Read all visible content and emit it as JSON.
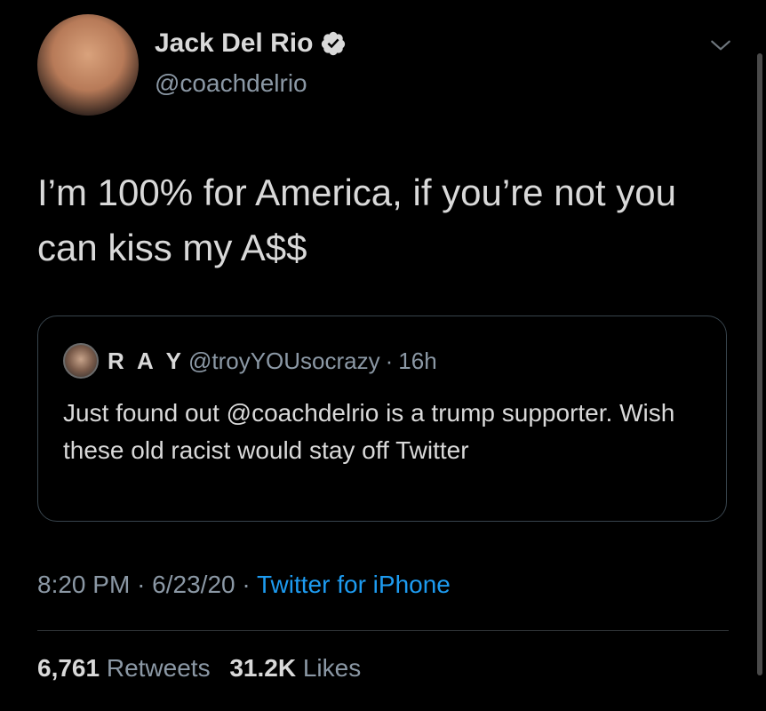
{
  "author": {
    "name": "Jack Del Rio",
    "handle": "@coachdelrio",
    "verified": true
  },
  "tweet": {
    "text": "I’m 100% for America, if you’re not you can kiss my A$$"
  },
  "quoted_tweet": {
    "name": "R A Y",
    "handle": "@troyYOUsocrazy",
    "separator": "·",
    "time": "16h",
    "text": "Just found out @coachdelrio  is a trump supporter. Wish these old racist would stay off Twitter"
  },
  "meta": {
    "time": "8:20 PM",
    "date": "6/23/20",
    "separator": "·",
    "source": "Twitter for iPhone"
  },
  "stats": {
    "retweets_count": "6,761",
    "retweets_label": "Retweets",
    "likes_count": "31.2K",
    "likes_label": "Likes"
  },
  "icons": {
    "verified": "verified-badge-icon",
    "chevron": "chevron-down-icon"
  },
  "colors": {
    "background": "#000000",
    "text": "#d9d9d9",
    "secondary": "#8b98a5",
    "link": "#1d9bf0",
    "border": "#38444d"
  }
}
